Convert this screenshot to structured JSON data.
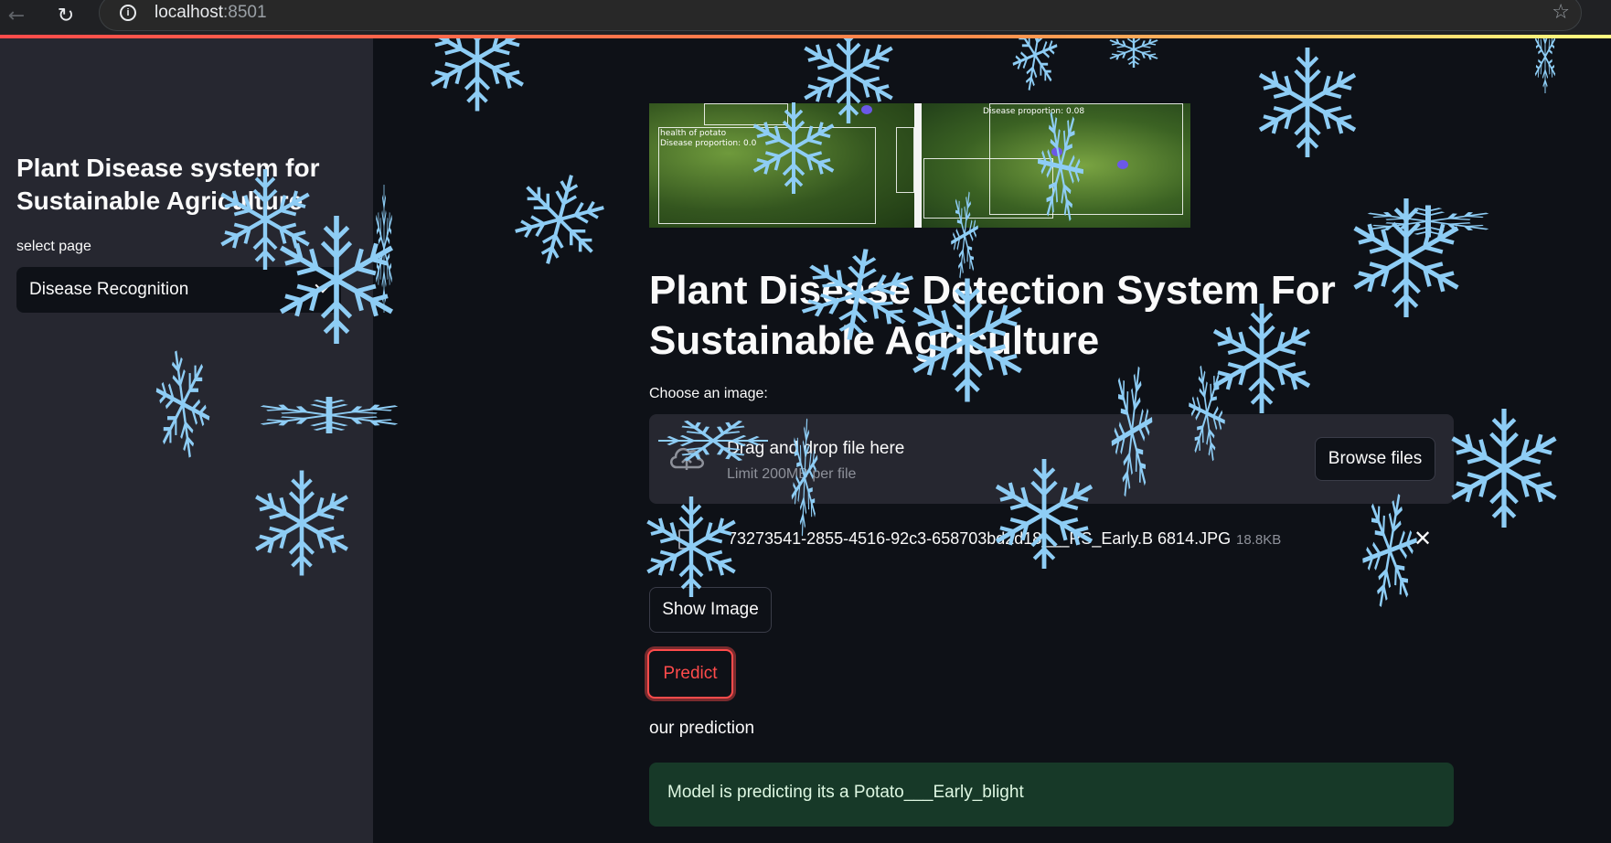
{
  "browser": {
    "url_host": "localhost",
    "url_port": ":8501"
  },
  "sidebar": {
    "title": "Plant Disease system for Sustainable Agriculture",
    "select_label": "select page",
    "select_value": "Disease Recognition"
  },
  "banner": {
    "left_text_1": "health of potato",
    "left_text_2": "Disease proportion: 0.0",
    "right_text": "Disease proportion: 0.08"
  },
  "main": {
    "title": "Plant Disease Detection System For Sustainable Agriculture",
    "uploader_label": "Choose an image:",
    "dropzone_text": "Drag and drop file here",
    "dropzone_limit": "Limit 200MB per file",
    "browse_label": "Browse files",
    "file_name": "73273541-2855-4516-92c3-658703bd2d18___RS_Early.B 6814.JPG",
    "file_size": "18.8KB",
    "show_image_label": "Show Image",
    "predict_label": "Predict",
    "prediction_heading": "our prediction",
    "prediction_result": "Model is predicting its a Potato___Early_blight"
  },
  "colors": {
    "accent": "#ff4b4b",
    "background": "#0e1117",
    "sidebar": "#262730",
    "success_bg": "#173928",
    "snowflake": "#8ecdf5"
  },
  "icons": {
    "back": "arrow-left-icon",
    "reload": "reload-icon",
    "info": "info-icon",
    "star": "star-icon",
    "upload": "cloud-upload-icon",
    "file": "file-icon",
    "close": "close-icon",
    "chevron": "chevron-down-icon",
    "snowflake": "snowflake-icon"
  }
}
